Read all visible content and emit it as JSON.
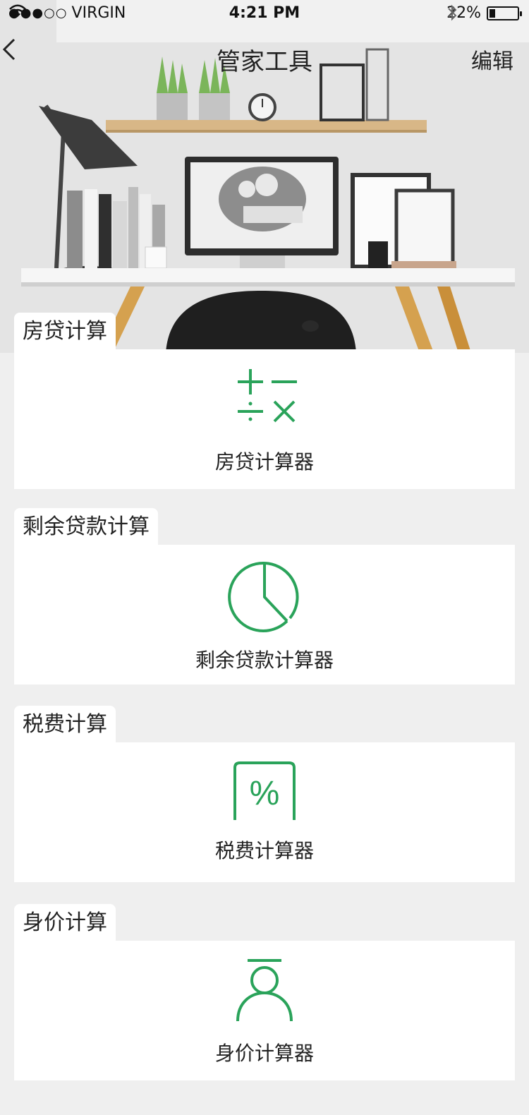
{
  "status": {
    "carrier": "VIRGIN",
    "signal_dots": "●●●○○",
    "time": "4:21 PM",
    "battery_percent": "22%",
    "battery_level": 0.22
  },
  "nav": {
    "title": "管家工具",
    "edit_label": "编辑",
    "back_icon": "chevron-left-icon"
  },
  "sections": [
    {
      "tab": "房贷计算",
      "label": "房贷计算器",
      "icon": "calculator-operators-icon",
      "color": "#2aa35a"
    },
    {
      "tab": "剩余贷款计算",
      "label": "剩余贷款计算器",
      "icon": "pie-chart-icon",
      "color": "#2aa35a"
    },
    {
      "tab": "税费计算",
      "label": "税费计算器",
      "icon": "percent-tag-icon",
      "color": "#2aa35a"
    },
    {
      "tab": "身价计算",
      "label": "身价计算器",
      "icon": "person-icon",
      "color": "#2aa35a"
    }
  ]
}
